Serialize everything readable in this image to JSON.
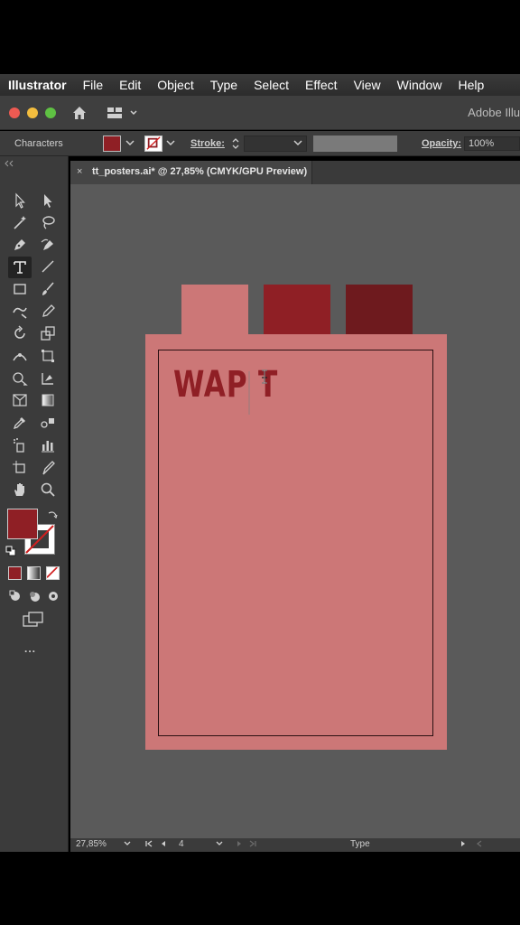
{
  "menubar": {
    "app": "Illustrator",
    "items": [
      "File",
      "Edit",
      "Object",
      "Type",
      "Select",
      "Effect",
      "View",
      "Window",
      "Help"
    ]
  },
  "appbar": {
    "title": "Adobe Illu"
  },
  "control": {
    "characters_label": "Characters",
    "stroke_label": "Stroke:",
    "opacity_label": "Opacity:",
    "opacity_value": "100%",
    "fill_color": "#8f1f25"
  },
  "document": {
    "tab_close": "×",
    "tab_title": "tt_posters.ai* @ 27,85% (CMYK/GPU Preview)"
  },
  "artwork": {
    "text": "WAP T",
    "text_color": "#8f1f25",
    "background_color": "#cc7777",
    "swatches": [
      "#cc7777",
      "#8f1f25",
      "#6e1a1e"
    ]
  },
  "status": {
    "zoom": "27,85%",
    "artboard": "4",
    "tool": "Type"
  },
  "tools": {
    "more": "..."
  }
}
